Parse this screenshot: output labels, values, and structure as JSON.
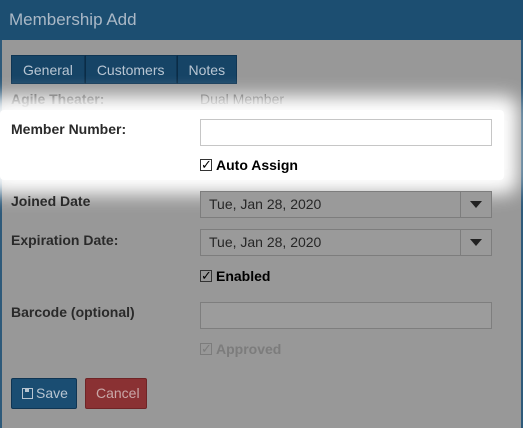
{
  "window": {
    "title": "Membership Add"
  },
  "tabs": [
    "General",
    "Customers",
    "Notes"
  ],
  "fields": {
    "agile_theater_label": "Agile Theater:",
    "agile_theater_value": "Dual Member",
    "member_number_label": "Member Number:",
    "member_number_value": "",
    "auto_assign_label": "Auto Assign",
    "joined_date_label": "Joined Date",
    "joined_date_value": "Tue, Jan 28, 2020",
    "expiration_date_label": "Expiration Date:",
    "expiration_date_value": "Tue, Jan 28, 2020",
    "enabled_label": "Enabled",
    "barcode_label": "Barcode (optional)",
    "barcode_value": "",
    "approved_label": "Approved"
  },
  "checks": {
    "mark": "✓"
  },
  "buttons": {
    "save": "Save",
    "cancel": "Cancel"
  },
  "colors": {
    "titlebar": "#1c4e71",
    "tab": "#164466",
    "save_button": "#1a4d72",
    "cancel_button": "#8a3133",
    "highlight": "#ffffff"
  }
}
